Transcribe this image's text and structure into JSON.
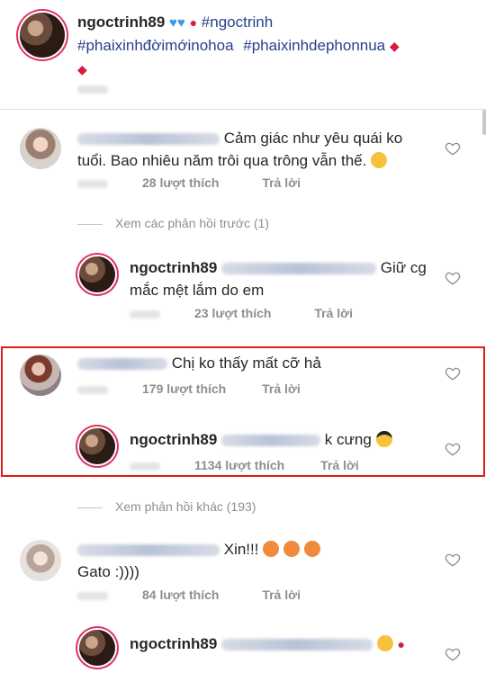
{
  "caption": {
    "username": "ngoctrinh89",
    "hashtags": [
      "#ngoctrinh",
      "#phaixinhđờimớinohoa",
      "#phaixinhdephonnua"
    ]
  },
  "comments": [
    {
      "text": "Cảm giác như yêu quái ko tuổi. Bao nhiêu năm trôi qua trông vẫn thế.",
      "line1": "Cảm giác như yêu quái ko",
      "line2": "tuổi. Bao nhiêu năm trôi qua trông vẫn thế.",
      "likes": "28 lượt thích",
      "reply_label": "Trả lời"
    }
  ],
  "view_previous": "Xem các phản hồi trước (1)",
  "reply1": {
    "username": "ngoctrinh89",
    "line1": "Giữ cg",
    "line2": "mắc mệt lắm do em",
    "likes": "23 lượt thích",
    "reply_label": "Trả lời"
  },
  "highlighted": {
    "comment_text": "Chị ko thấy mất cỡ hả",
    "comment_likes": "179 lượt thích",
    "comment_reply": "Trả lời",
    "reply_username": "ngoctrinh89",
    "reply_text": "k cưng",
    "reply_likes": "1134 lượt thích",
    "reply_reply": "Trả lời"
  },
  "view_more": "Xem phản hồi khác (193)",
  "comment3": {
    "text1": "Xin!!!",
    "text2": "Gato :))))",
    "likes": "84 lượt thích",
    "reply_label": "Trả lời"
  },
  "reply3": {
    "username": "ngoctrinh89"
  },
  "colors": {
    "highlight_border": "#e01b1b",
    "hashtag": "#27408b",
    "meta_text": "#8e8e8e"
  }
}
